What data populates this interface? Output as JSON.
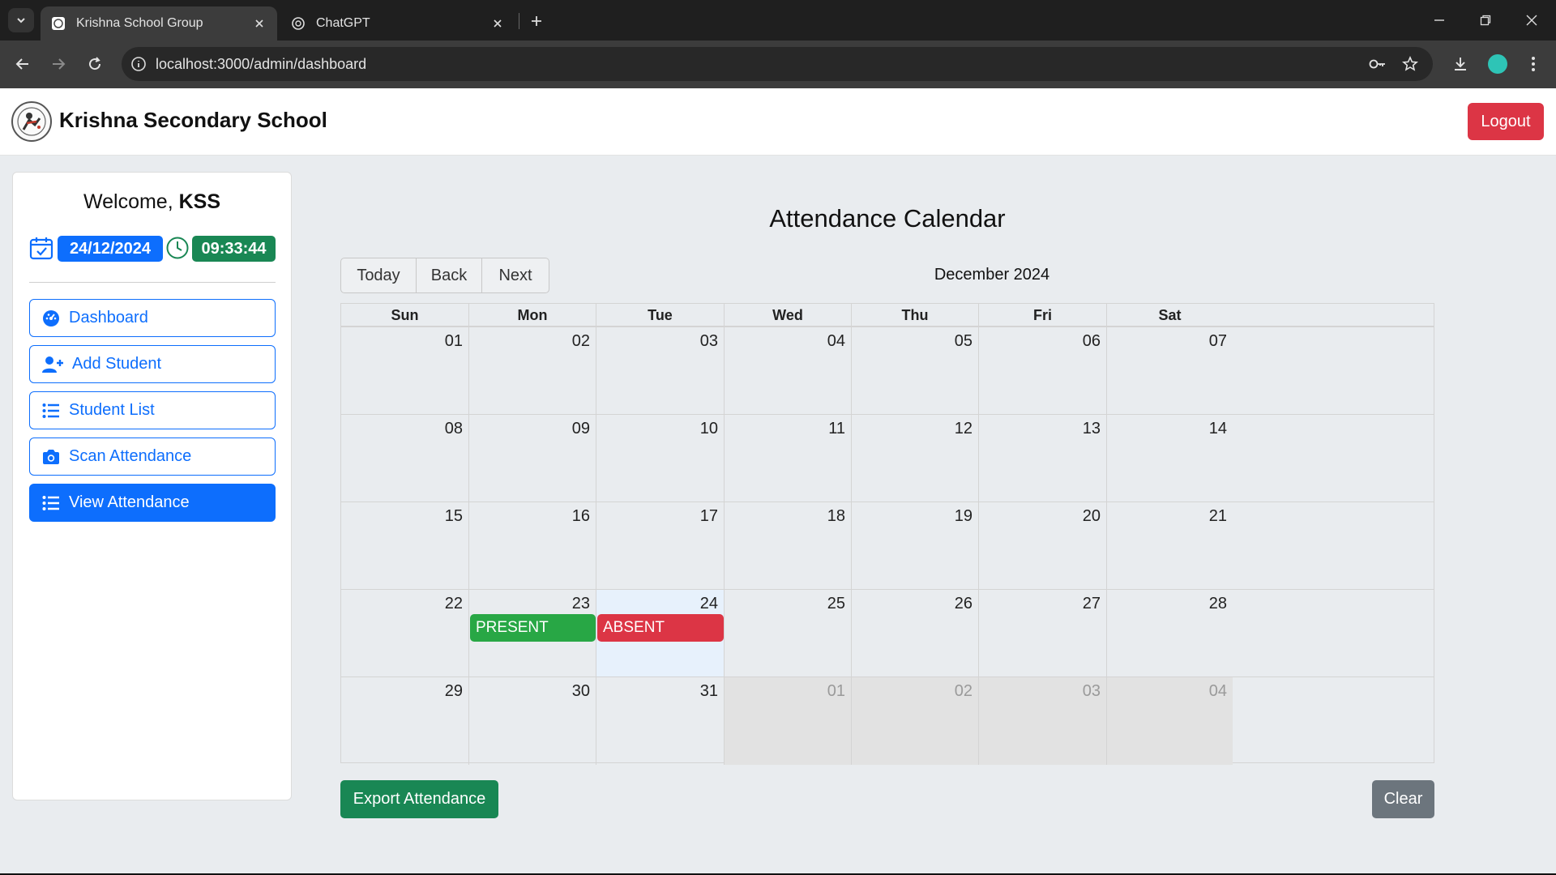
{
  "browser": {
    "tabs": [
      {
        "title": "Krishna School Group",
        "active": true
      },
      {
        "title": "ChatGPT",
        "active": false
      }
    ],
    "url": "localhost:3000/admin/dashboard"
  },
  "header": {
    "school_name": "Krishna Secondary School",
    "logout_label": "Logout"
  },
  "sidebar": {
    "welcome_prefix": "Welcome, ",
    "user": "KSS",
    "date": "24/12/2024",
    "time": "09:33:44",
    "items": [
      {
        "label": "Dashboard",
        "icon": "dashboard-icon",
        "active": false
      },
      {
        "label": "Add Student",
        "icon": "add-user-icon",
        "active": false
      },
      {
        "label": "Student List",
        "icon": "list-icon",
        "active": false
      },
      {
        "label": "Scan Attendance",
        "icon": "camera-icon",
        "active": false
      },
      {
        "label": "View Attendance",
        "icon": "list-icon",
        "active": true
      }
    ]
  },
  "main": {
    "title": "Attendance Calendar",
    "nav": {
      "today": "Today",
      "back": "Back",
      "next": "Next"
    },
    "month_label": "December 2024",
    "weekdays": [
      "Sun",
      "Mon",
      "Tue",
      "Wed",
      "Thu",
      "Fri",
      "Sat"
    ],
    "weeks": [
      [
        "01",
        "02",
        "03",
        "04",
        "05",
        "06",
        "07"
      ],
      [
        "08",
        "09",
        "10",
        "11",
        "12",
        "13",
        "14"
      ],
      [
        "15",
        "16",
        "17",
        "18",
        "19",
        "20",
        "21"
      ],
      [
        "22",
        "23",
        "24",
        "25",
        "26",
        "27",
        "28"
      ],
      [
        "29",
        "30",
        "31",
        "01",
        "02",
        "03",
        "04"
      ]
    ],
    "events": [
      {
        "day": "23",
        "label": "PRESENT",
        "status": "present"
      },
      {
        "day": "24",
        "label": "ABSENT",
        "status": "absent"
      }
    ],
    "today_day": "24",
    "export_label": "Export Attendance",
    "clear_label": "Clear"
  },
  "colors": {
    "primary": "#0d6efd",
    "success": "#198754",
    "present": "#28a745",
    "danger": "#dc3545",
    "secondary": "#6c757d"
  }
}
